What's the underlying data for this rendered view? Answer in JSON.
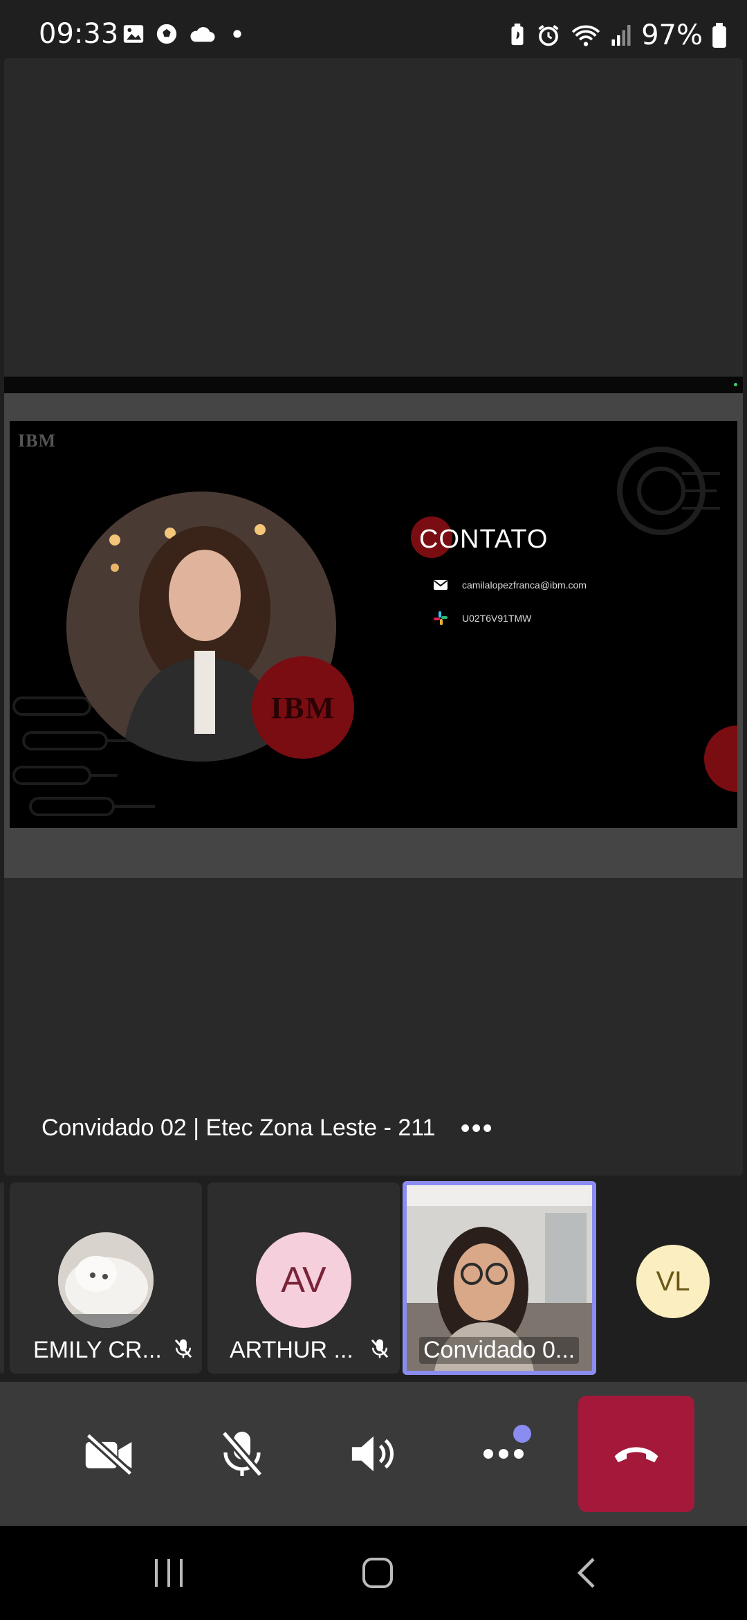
{
  "status_bar": {
    "time": "09:33",
    "battery": "97%",
    "left_icons": [
      "image-icon",
      "soccer-ball-icon",
      "cloud-icon",
      "dot-icon"
    ],
    "right_icons": [
      "battery-saver-icon",
      "alarm-icon",
      "wifi-icon",
      "signal-icon",
      "battery-icon"
    ]
  },
  "slide": {
    "logo": "IBM",
    "badge_logo": "IBM",
    "title": "CONTATO",
    "contacts": [
      {
        "icon": "mail-icon",
        "text": "camilalopezfranca@ibm.com"
      },
      {
        "icon": "slack-icon",
        "text": "U02T6V91TMW"
      }
    ],
    "colors": {
      "accent_red": "#7a0d12",
      "background": "#000000"
    }
  },
  "meeting": {
    "title": "Convidado 02 | Etec Zona Leste - 211",
    "more_label": "•••"
  },
  "participants": [
    {
      "name": "EMILY CR...",
      "muted": true,
      "avatar": "cat-photo"
    },
    {
      "name": "ARTHUR ...",
      "muted": true,
      "initials": "AV"
    },
    {
      "name": "Convidado 0...",
      "video": true,
      "active_speaker": true
    },
    {
      "initials": "VL"
    }
  ],
  "controls": {
    "camera": "camera-off-icon",
    "mic": "mic-off-icon",
    "speaker": "speaker-icon",
    "more": "more-icon",
    "end_call": "end-call-icon",
    "colors": {
      "end_call": "#a4193a",
      "highlight": "#8b8cf0"
    }
  },
  "navbar": [
    "recent-apps-icon",
    "home-icon",
    "back-icon"
  ]
}
